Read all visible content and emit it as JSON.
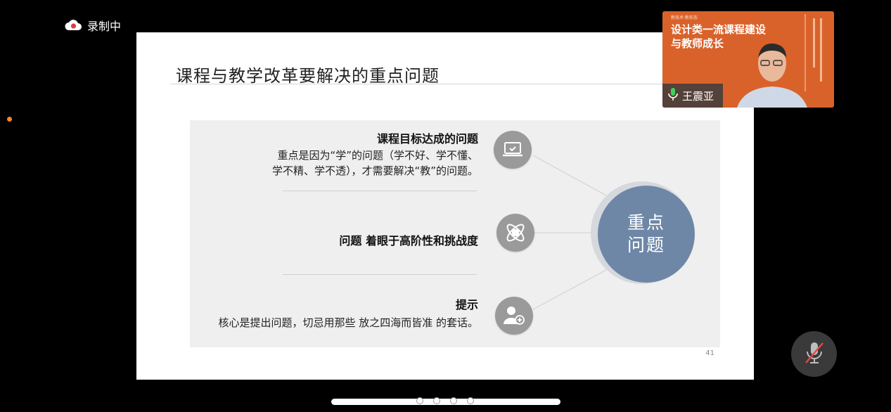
{
  "recording": {
    "label": "录制中"
  },
  "slide": {
    "title": "课程与教学改革要解决的重点问题",
    "items": [
      {
        "heading": "课程目标达成的问题",
        "desc_line1": "重点是因为“学”的问题（学不好、学不懂、",
        "desc_line2": "学不精、学不透），才需要解决“教”的问题。"
      },
      {
        "heading": "问题 着眼于高阶性和挑战度"
      },
      {
        "heading": "提示",
        "desc_line1": "核心是提出问题，切忌用那些 放之四海而皆准 的套话。"
      }
    ],
    "center": {
      "line1": "重点",
      "line2": "问题"
    },
    "page_number": "41"
  },
  "webcam": {
    "small_text": "新技术·新形态",
    "title_line1": "设计类一流课程建设",
    "title_line2": "与教师成长",
    "speaker_name": "王震亚"
  },
  "icons": {
    "item1": "laptop-check-icon",
    "item2": "atom-icon",
    "item3": "user-add-icon",
    "mic": "mic-muted-icon",
    "rec": "cloud-record-icon"
  },
  "colors": {
    "center_circle": "#6e87a6",
    "webcam_bg": "#d9622b",
    "icon_circle": "#9a9a9a"
  }
}
